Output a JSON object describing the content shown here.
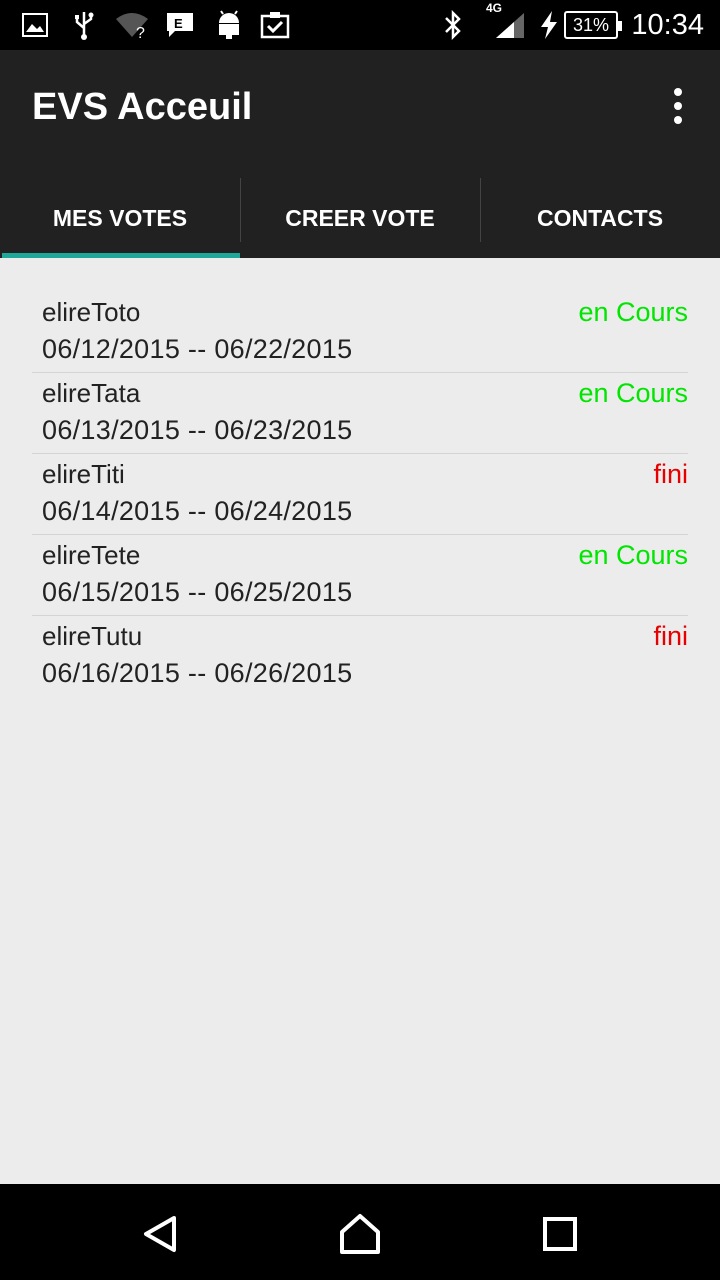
{
  "status_bar": {
    "icons": [
      "gallery-icon",
      "usb-icon",
      "wifi-unknown-icon",
      "notification-icon",
      "android-icon",
      "clipboard-check-icon",
      "bluetooth-icon",
      "signal-icon",
      "charging-icon"
    ],
    "network": "4G",
    "battery": "31%",
    "time": "10:34"
  },
  "app_bar": {
    "title": "EVS Acceuil"
  },
  "tabs": [
    {
      "label": "MES VOTES",
      "active": true
    },
    {
      "label": "CREER VOTE",
      "active": false
    },
    {
      "label": "CONTACTS",
      "active": false
    }
  ],
  "votes": [
    {
      "name": "elireToto",
      "dates": "06/12/2015 --  06/22/2015",
      "status": "en Cours",
      "status_color": "#00e600"
    },
    {
      "name": "elireTata",
      "dates": "06/13/2015 --  06/23/2015",
      "status": "en Cours",
      "status_color": "#00e600"
    },
    {
      "name": "elireTiti",
      "dates": "06/14/2015 --  06/24/2015",
      "status": "fini",
      "status_color": "#e60000"
    },
    {
      "name": "elireTete",
      "dates": "06/15/2015 --  06/25/2015",
      "status": "en Cours",
      "status_color": "#00e600"
    },
    {
      "name": "elireTutu",
      "dates": "06/16/2015 --  06/26/2015",
      "status": "fini",
      "status_color": "#e60000"
    }
  ],
  "colors": {
    "app_bar": "#212121",
    "tab_indicator": "#1fa89a",
    "background": "#ececec"
  }
}
